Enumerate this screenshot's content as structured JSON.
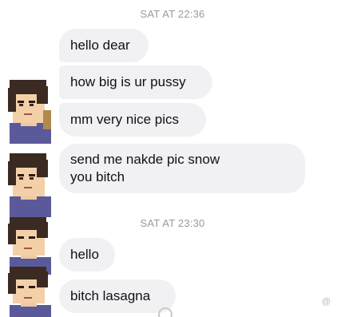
{
  "thread": {
    "timestamps": [
      "SAT AT 22:36",
      "SAT AT 23:30"
    ],
    "messages": [
      {
        "text": "hello dear"
      },
      {
        "text": "how big is ur pussy"
      },
      {
        "text": "mm very nice pics"
      },
      {
        "text_line1": "send me nakde pic snow",
        "text_line2": "you bitch"
      },
      {
        "text": "hello"
      },
      {
        "text": "bitch lasagna"
      }
    ]
  },
  "watermark": "@"
}
